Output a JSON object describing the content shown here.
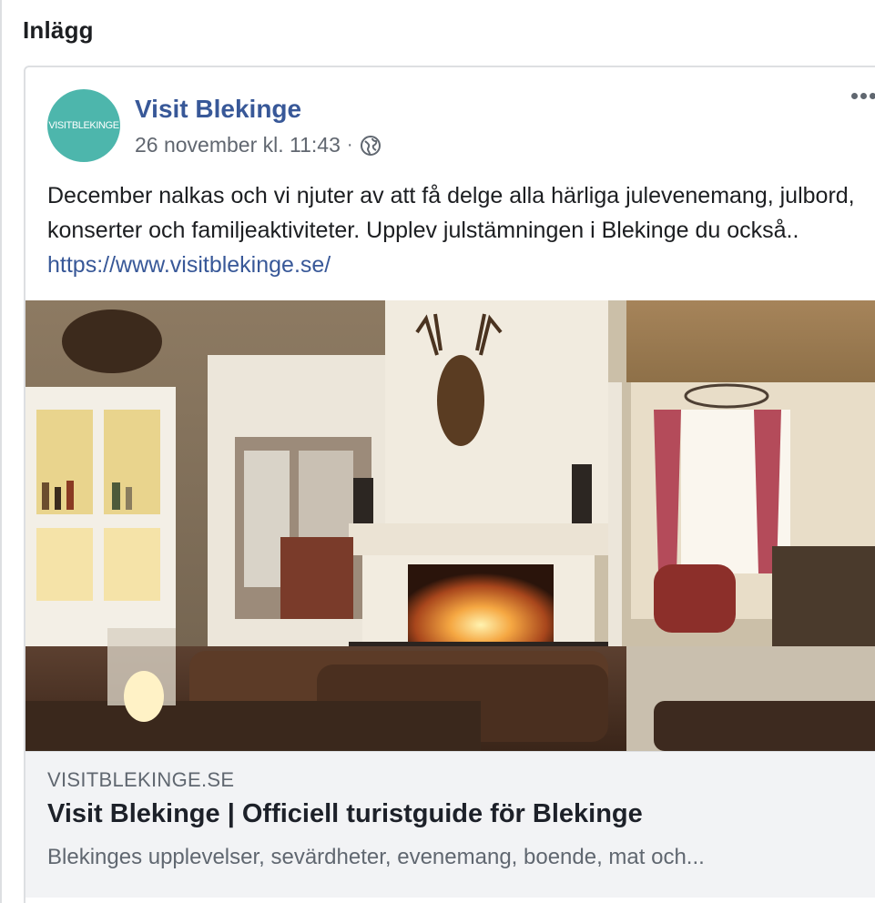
{
  "section": {
    "title": "Inlägg"
  },
  "post": {
    "avatar_text": "VISITBLEKINGE",
    "page_name": "Visit Blekinge",
    "timestamp": "26 november kl. 11:43",
    "separator": "·",
    "audience_icon": "globe-icon",
    "more_icon": "more-options-icon",
    "text": "December nalkas och vi njuter av att få delge alla härliga julevenemang, julbord, konserter och familjeaktiviteter. Upplev julstämningen i Blekinge du också.. ",
    "link_text": "https://www.visitblekinge.se/"
  },
  "link_preview": {
    "domain": "VISITBLEKINGE.SE",
    "title": "Visit Blekinge | Officiell turistguide för Blekinge",
    "description": "Blekinges upplevelser, sevärdheter, evenemang, boende, mat och..."
  },
  "colors": {
    "link_blue": "#385898",
    "avatar_teal": "#4db6ac",
    "preview_bg": "#f2f3f5"
  }
}
